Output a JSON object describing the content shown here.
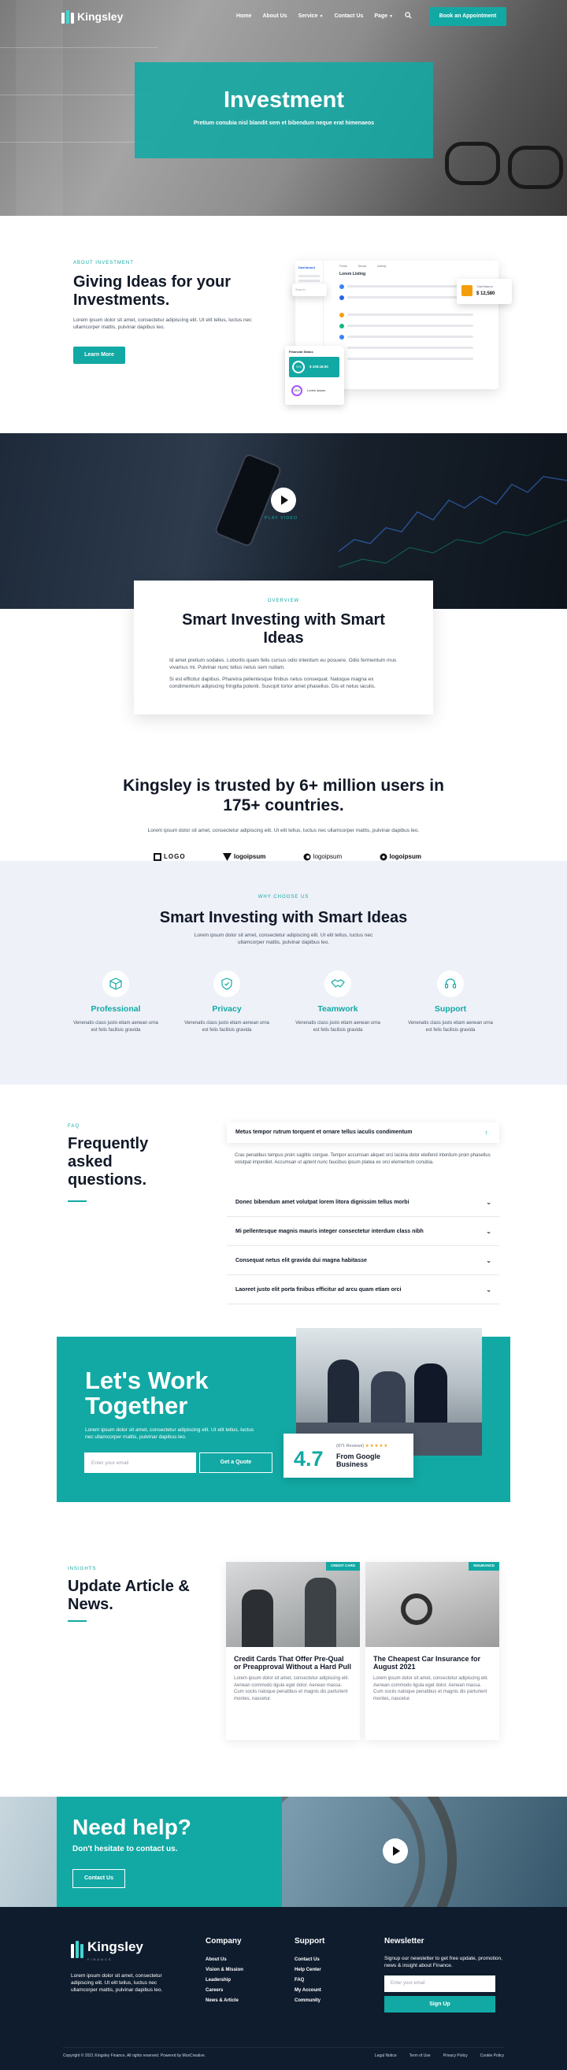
{
  "brand": {
    "name": "Kingsley",
    "accent": "#12a9a4",
    "dark": "#0f1c2e"
  },
  "nav": {
    "items": [
      {
        "label": "Home",
        "dropdown": false
      },
      {
        "label": "About Us",
        "dropdown": false
      },
      {
        "label": "Service",
        "dropdown": true
      },
      {
        "label": "Contact Us",
        "dropdown": false
      },
      {
        "label": "Page",
        "dropdown": true
      }
    ],
    "search_icon": "search-icon",
    "cta": "Book an Appointment"
  },
  "hero": {
    "title": "Investment",
    "subtitle": "Pretium conubia nisl blandit sem et bibendum neque erat himenaeos"
  },
  "about": {
    "eyebrow": "ABOUT INVESTMENT",
    "title": "Giving Ideas for your Investments.",
    "text": "Lorem ipsum dolor sit amet, consectetur adipiscing elit. Ut elit tellus, luctus nec ullamcorper mattis, pulvinar dapibus leo.",
    "button": "Learn More",
    "dashboard": {
      "brand": "Dashboard",
      "tabs": [
        "Funds",
        "Stocks",
        "Activity"
      ],
      "section": "Lorem Listing",
      "balance_label": "Total Balance",
      "balance": "$ 12,580",
      "card_label": "Financial Status",
      "card_percent": "72%",
      "card_amount": "$ 109.18.00",
      "card_percent2": "24%",
      "card_name": "Lorem Ipsum",
      "search_placeholder": "Search"
    }
  },
  "video": {
    "play_label": "PLAY VIDEO"
  },
  "overview": {
    "eyebrow": "OVERVIEW",
    "title": "Smart Investing with Smart Ideas",
    "p1": "Id amet pretium sodales. Lobortis quam felis cursus odio interdum eu posuere. Odio fermentum mus vivamus mi. Pulvinar nunc tellus netus sem nullam.",
    "p2": "Si est efficitur dapibus. Pharetra pellentesque finibus netus consequat. Natoque magna ex condimentum adipiscing fringilla potenti. Suscipit tortor amet phasellus. Dis et netus iaculis."
  },
  "trust": {
    "title": "Kingsley is trusted by 6+ million users in 175+ countries.",
    "text": "Lorem ipsum dolor sit amet, consectetur adipiscing elit. Ut elit tellus, luctus nec ullamcorper mattis, pulvinar dapibus leo.",
    "logos": [
      "LOGO",
      "logoipsum",
      "logoipsum",
      "logoipsum"
    ]
  },
  "why": {
    "eyebrow": "WHY CHOOSE US",
    "title": "Smart Investing with Smart Ideas",
    "text": "Lorem ipsum dolor sit amet, consectetur adipiscing elit. Ut elit tellus, luctus nec ullamcorper mattis, pulvinar dapibus leo.",
    "features": [
      {
        "title": "Professional",
        "icon": "cube-icon",
        "text": "Venenatis class justo etiam aenean urna est felis facilisis gravida"
      },
      {
        "title": "Privacy",
        "icon": "shield-icon",
        "text": "Venenatis class justo etiam aenean urna est felis facilisis gravida"
      },
      {
        "title": "Teamwork",
        "icon": "handshake-icon",
        "text": "Venenatis class justo etiam aenean urna est felis facilisis gravida"
      },
      {
        "title": "Support",
        "icon": "support-icon",
        "text": "Venenatis class justo etiam aenean urna est felis facilisis gravida"
      }
    ]
  },
  "faq": {
    "eyebrow": "FAQ",
    "title": "Frequently asked questions.",
    "open_question": "Metus tempor rutrum torquent et ornare tellus iaculis condimentum",
    "open_answer": "Cras penatibus tempus proin sagittis congue. Tempor accumsan aliquet orci lacinia dolor eleifend interdum proin phasellus volutpat imperdiet. Accumsan ut aptent nunc faucibus ipsum platea ex orci elementum conubia.",
    "questions": [
      "Donec bibendum amet volutpat lorem litora dignissim tellus morbi",
      "Mi pellentesque magnis mauris integer consectetur interdum class nibh",
      "Consequat netus elit gravida dui magna habitasse",
      "Laoreet justo elit porta finibus efficitur ad arcu quam etiam orci"
    ]
  },
  "cta": {
    "title": "Let's Work Together",
    "text": "Lorem ipsum dolor sit amet, consectetur adipiscing elit. Ut elit tellus, luctus nec ullamcorper mattis, pulvinar dapibus leo.",
    "placeholder": "Enter your email",
    "button": "Get a Quote",
    "rating": "4.7",
    "reviews": "(871 Reviews)",
    "stars": 5,
    "rating_source": "From Google Business"
  },
  "news": {
    "eyebrow": "INSIGHTS",
    "title": "Update Article & News.",
    "articles": [
      {
        "tag": "CREDIT CARD",
        "title": "Credit Cards That Offer Pre-Qual or Preapproval Without a Hard Pull",
        "text": "Lorem ipsum dolor sit amet, consectetur adipiscing elit. Aenean commodo ligula eget dolor. Aenean massa. Cum sociis natoque penatibus et magnis dis parturient montes, nascetur."
      },
      {
        "tag": "INSURANCE",
        "title": "The Cheapest Car Insurance for August 2021",
        "text": "Lorem ipsum dolor sit amet, consectetur adipiscing elit. Aenean commodo ligula eget dolor. Aenean massa. Cum sociis natoque penatibus et magnis dis parturient montes, nascetur."
      }
    ]
  },
  "help": {
    "title": "Need help?",
    "subtitle": "Don't hesitate to contact us.",
    "button": "Contact Us"
  },
  "footer": {
    "logo_sub": "FINANCE",
    "about": "Lorem ipsum dolor sit amet, consectetur adipiscing elit. Ut elit tellus, luctus nec ullamcorper mattis, pulvinar dapibus leo.",
    "company_title": "Company",
    "company": [
      "About Us",
      "Vision & Mission",
      "Leadership",
      "Careers",
      "News & Article"
    ],
    "support_title": "Support",
    "support": [
      "Contact Us",
      "Help Center",
      "FAQ",
      "My Account",
      "Community"
    ],
    "newsletter_title": "Newsletter",
    "newsletter_text": "Signup our newsletter to get free update, promotion, news & insight about Finance.",
    "newsletter_placeholder": "Enter your email",
    "newsletter_button": "Sign Up",
    "copyright": "Copyright © 2021 Kingsley Finance, All rights reserved. Powered by MoxCreative.",
    "links": [
      "Legal Notice",
      "Term of Use",
      "Privacy Policy",
      "Cookie Policy"
    ]
  }
}
